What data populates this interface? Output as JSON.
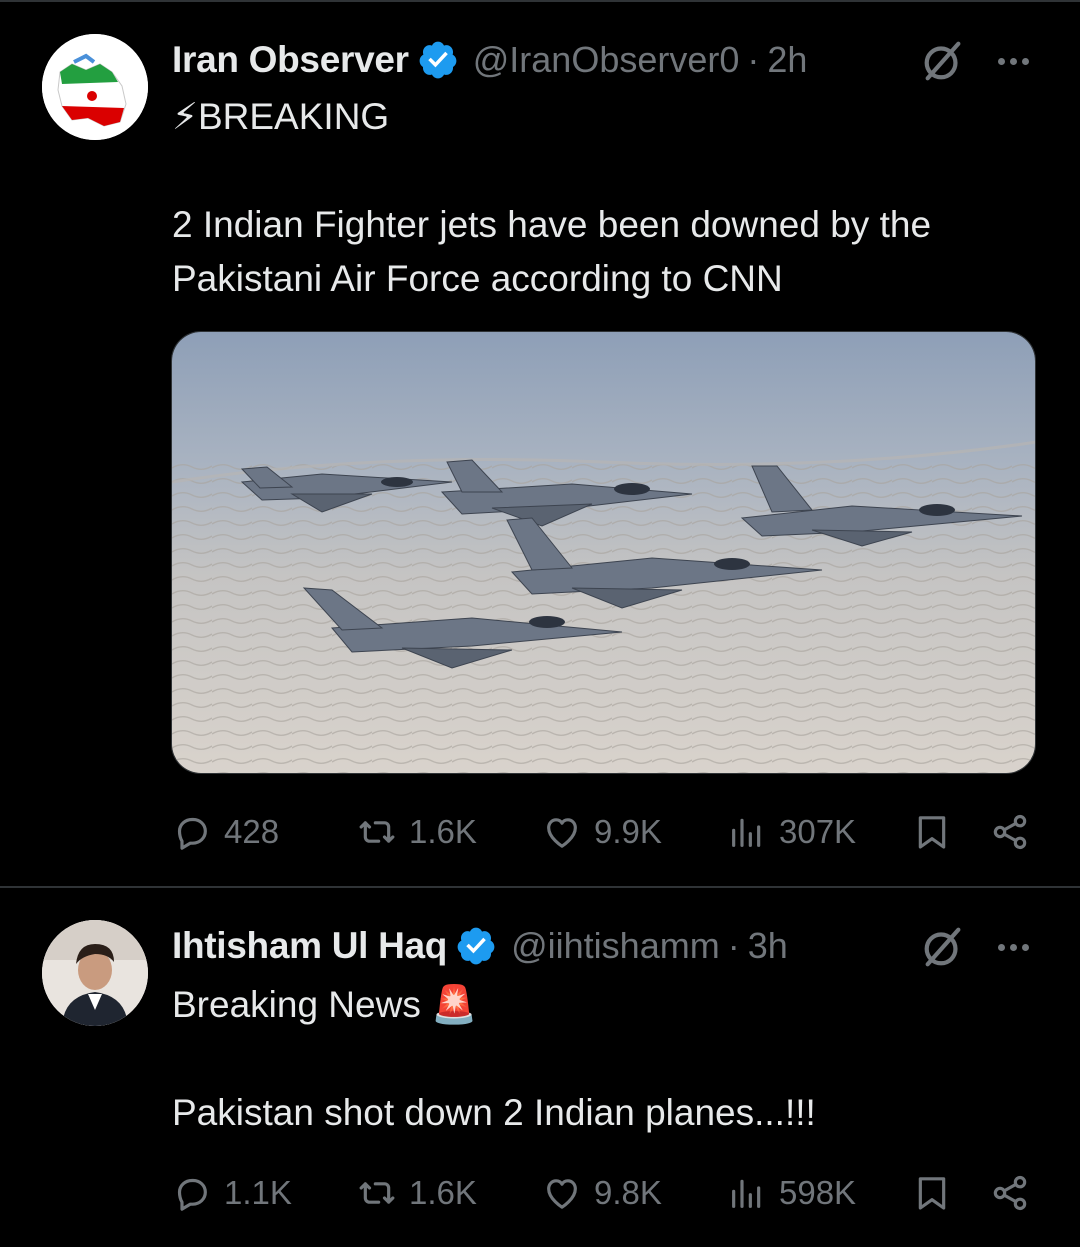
{
  "tweets": [
    {
      "author_name": "Iran Observer",
      "handle": "@IranObserver0",
      "separator": "·",
      "time": "2h",
      "text": "⚡BREAKING\n\n2 Indian Fighter jets have been downed by the Pakistani Air Force according to CNN",
      "media_alt": "Four fighter jets flying in formation over desert terrain",
      "stats": {
        "replies": "428",
        "reposts": "1.6K",
        "likes": "9.9K",
        "views": "307K"
      }
    },
    {
      "author_name": "Ihtisham Ul Haq",
      "handle": "@iihtishamm",
      "separator": "·",
      "time": "3h",
      "text": "Breaking News 🚨\n\nPakistan shot down 2 Indian planes...!!!",
      "stats": {
        "replies": "1.1K",
        "reposts": "1.6K",
        "likes": "9.8K",
        "views": "598K"
      }
    }
  ],
  "colors": {
    "background": "#000000",
    "text": "#e7e9ea",
    "secondary": "#71767b",
    "verified": "#1d9bf0",
    "divider": "#2f3336"
  },
  "icons": [
    "verified-badge-icon",
    "grok-icon",
    "more-icon",
    "reply-icon",
    "repost-icon",
    "like-icon",
    "views-icon",
    "bookmark-icon",
    "share-icon"
  ]
}
